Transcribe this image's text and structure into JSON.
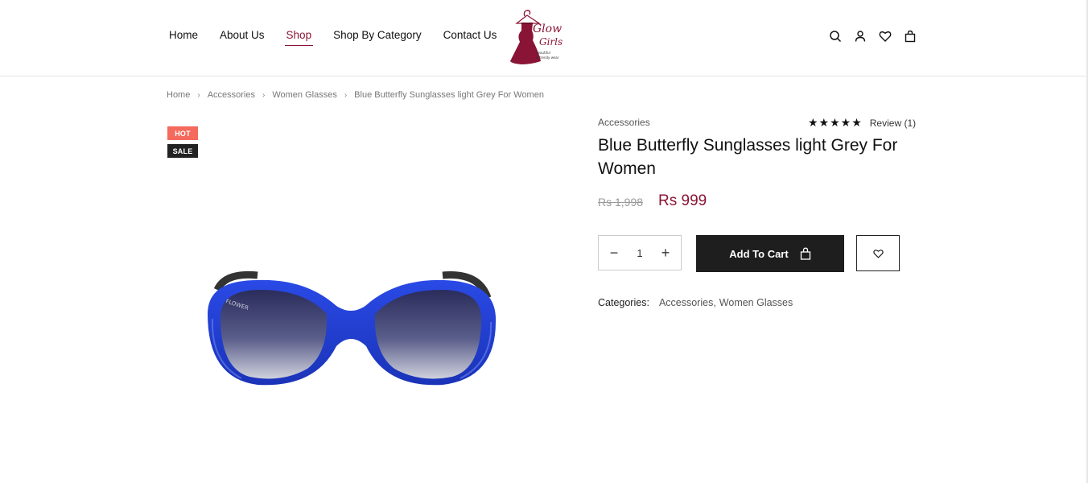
{
  "nav": {
    "items": [
      {
        "label": "Home"
      },
      {
        "label": "About Us"
      },
      {
        "label": "Shop"
      },
      {
        "label": "Shop By Category"
      },
      {
        "label": "Contact Us"
      }
    ],
    "active": "Shop"
  },
  "logo": {
    "line1": "Glow",
    "line2": "Girls",
    "tagline1": "beautiful",
    "tagline2": "& trendy wear"
  },
  "header_icons": [
    "search-icon",
    "user-icon",
    "heart-icon",
    "bag-icon"
  ],
  "breadcrumb": {
    "items": [
      "Home",
      "Accessories",
      "Women Glasses"
    ],
    "current": "Blue Butterfly Sunglasses light Grey For Women"
  },
  "badges": {
    "hot": "HOT",
    "sale": "SALE"
  },
  "product": {
    "category": "Accessories",
    "rating_stars": "★★★★★",
    "rating_value": 5,
    "review_label": "Review (1)",
    "title": "Blue Butterfly Sunglasses light Grey For Women",
    "old_price": "Rs 1,998",
    "new_price": "Rs 999",
    "quantity": "1",
    "add_to_cart_label": "Add To Cart",
    "categories_label": "Categories:",
    "categories": [
      "Accessories,",
      "Women Glasses"
    ],
    "frame_print": "FLOWER"
  },
  "colors": {
    "accent": "#8a1435",
    "hot_badge": "#f46a5c",
    "dark": "#1e1e1e",
    "frame_blue": "#1f3fd8"
  }
}
